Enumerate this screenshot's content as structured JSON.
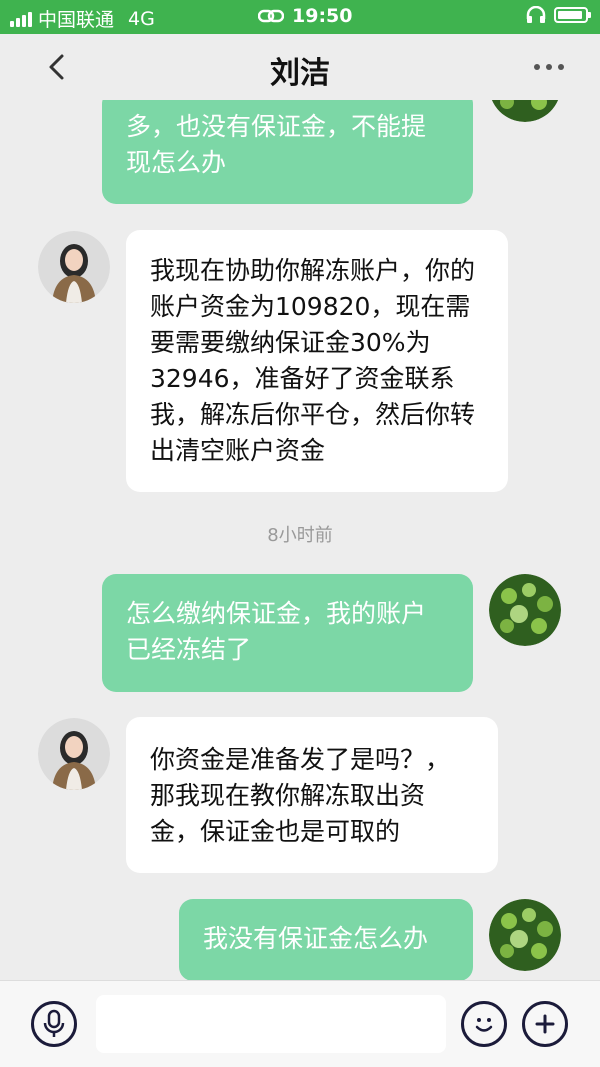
{
  "status_bar": {
    "carrier": "中国联通",
    "network": "4G",
    "time": "19:50"
  },
  "header": {
    "title": "刘洁"
  },
  "messages": [
    {
      "direction": "out",
      "lines": [
        "多，也没有保证金，不能提",
        "现怎么办"
      ]
    },
    {
      "direction": "in",
      "lines": [
        "我现在协助你解冻账户，你的",
        "账户资金为109820，现在需",
        "要需要缴纳保证金30%为",
        "32946，准备好了资金联系",
        "我，解冻后你平仓，然后你转",
        "出清空账户资金"
      ]
    },
    {
      "direction": "out",
      "lines": [
        "怎么缴纳保证金，我的账户",
        "已经冻结了"
      ]
    },
    {
      "direction": "in",
      "lines": [
        "你资金是准备发了是吗？，",
        "那我现在教你解冻取出资",
        "金，保证金也是可取的"
      ]
    },
    {
      "direction": "out",
      "lines": [
        "我没有保证金怎么办"
      ]
    }
  ],
  "timestamp": "8小时前",
  "icons": {
    "back": "chevron-left-icon",
    "more": "more-dots-icon",
    "voice": "microphone-icon",
    "emoji": "smiley-icon",
    "add": "plus-icon"
  },
  "colors": {
    "status_bar": "#3fb34f",
    "outgoing_bubble": "#7cd7a6",
    "incoming_bubble": "#ffffff",
    "background": "#ededed"
  }
}
